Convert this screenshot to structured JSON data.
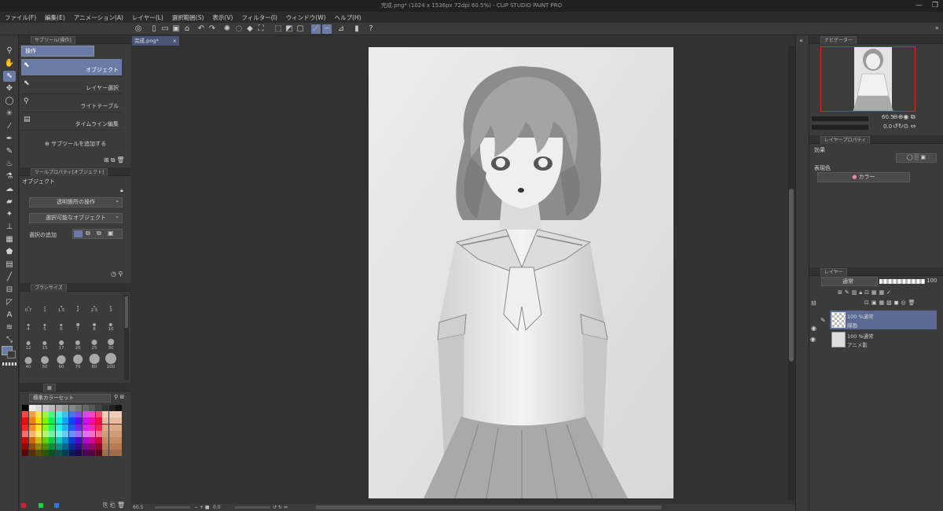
{
  "window": {
    "title": "完成.png* (1024 x 1536px 72dpi 60.5%) - CLIP STUDIO PAINT PRO",
    "controls": [
      "—",
      "❐"
    ]
  },
  "menu": [
    "ファイル(F)",
    "編集(E)",
    "アニメーション(A)",
    "レイヤー(L)",
    "選択範囲(S)",
    "表示(V)",
    "フィルター(I)",
    "ウィンドウ(W)",
    "ヘルプ(H)"
  ],
  "sub_tool": {
    "header": "サブツール[操作]",
    "group": "操作",
    "items": [
      {
        "label": "オブジェクト",
        "selected": true
      },
      {
        "label": "レイヤー選択",
        "selected": false
      },
      {
        "label": "ライトテーブル",
        "selected": false
      },
      {
        "label": "タイムライン編集",
        "selected": false
      }
    ],
    "add_label": "サブツールを追加する"
  },
  "tool_property": {
    "header": "ツールプロパティ[オブジェクト]",
    "title": "オブジェクト",
    "drop1": "透明箇所の操作",
    "drop2": "選択可能なオブジェクト",
    "add_selection_label": "選択の追加"
  },
  "brush_size": {
    "header": "ブラシサイズ",
    "sizes": [
      "0.7",
      "1",
      "1.5",
      "2",
      "2.5",
      "3",
      "4",
      "5",
      "6",
      "7",
      "8",
      "10",
      "12",
      "15",
      "17",
      "20",
      "25",
      "30",
      "40",
      "50",
      "60",
      "70",
      "80",
      "100"
    ]
  },
  "color_set": {
    "name": "標準カラーセット"
  },
  "canvas": {
    "tab": "完成.png*",
    "zoom": "60.5",
    "angle": "0.0"
  },
  "navigator": {
    "tab": "ナビゲーター",
    "zoom": "60.5",
    "angle": "0.0"
  },
  "layer_property": {
    "tab": "レイヤープロパティ",
    "effect": "効果",
    "expression_color": "表現色",
    "color_mode": "カラー"
  },
  "layers": {
    "tab": "レイヤー",
    "blend": "通常",
    "opacity": "100",
    "items": [
      {
        "mode": "100 %通常",
        "name": "線画",
        "selected": true
      },
      {
        "mode": "100 %通常",
        "name": "アニメ影",
        "selected": false
      }
    ]
  },
  "colors": {
    "accent": "#6a7ba6",
    "nav_frame": "#e0261d"
  }
}
